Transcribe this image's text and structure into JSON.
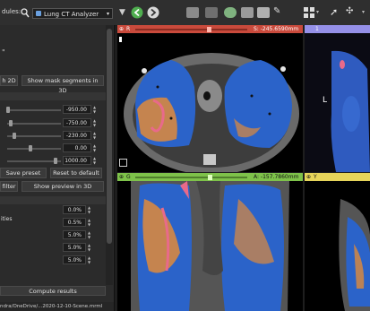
{
  "toolbar": {
    "modules_label": "dules:",
    "module_selected": "Lung CT Analyzer",
    "icons": [
      "search-icon",
      "module-combo-arrow",
      "back-arrow-icon",
      "forward-arrow-icon",
      "toolbar-tool-icons"
    ]
  },
  "left_panel": {
    "show_2d_label": "h 2D",
    "show_3d_label": "Show mask segments in 3D",
    "thresholds": [
      "-950.00",
      "-750.00",
      "-230.00",
      "0.00",
      "1000.00"
    ],
    "save_preset_label": "Save preset",
    "reset_default_label": "Reset to default",
    "filter_label": "filter",
    "show_preview_label": "Show preview in 3D",
    "section_label": "ities",
    "percentages": [
      "0.0%",
      "0.5%",
      "5.0%",
      "5.0%",
      "5.0%"
    ],
    "compute_label": "Compute results"
  },
  "status_bar": {
    "path": "ndra/OneDrive/...2020-12-10-Scene.mrml"
  },
  "viewers": {
    "red": {
      "letter": "R",
      "slice_text": "S: -245.6590mm"
    },
    "purple": {
      "letter": "1",
      "orientation_label": "L"
    },
    "green": {
      "letter": "G",
      "slice_text": "A: -157.7860mm"
    },
    "yellow": {
      "letter": "Y",
      "slice_text": ""
    }
  },
  "colors": {
    "red_viewer": "#c94a3c",
    "green_viewer": "#7ec24a",
    "yellow_viewer": "#e6d45a",
    "purple_viewer": "#9590e8",
    "lung_blue": "#2b63c9",
    "lung_orange": "#e08a3a",
    "vessel_pink": "#e86a8a"
  }
}
